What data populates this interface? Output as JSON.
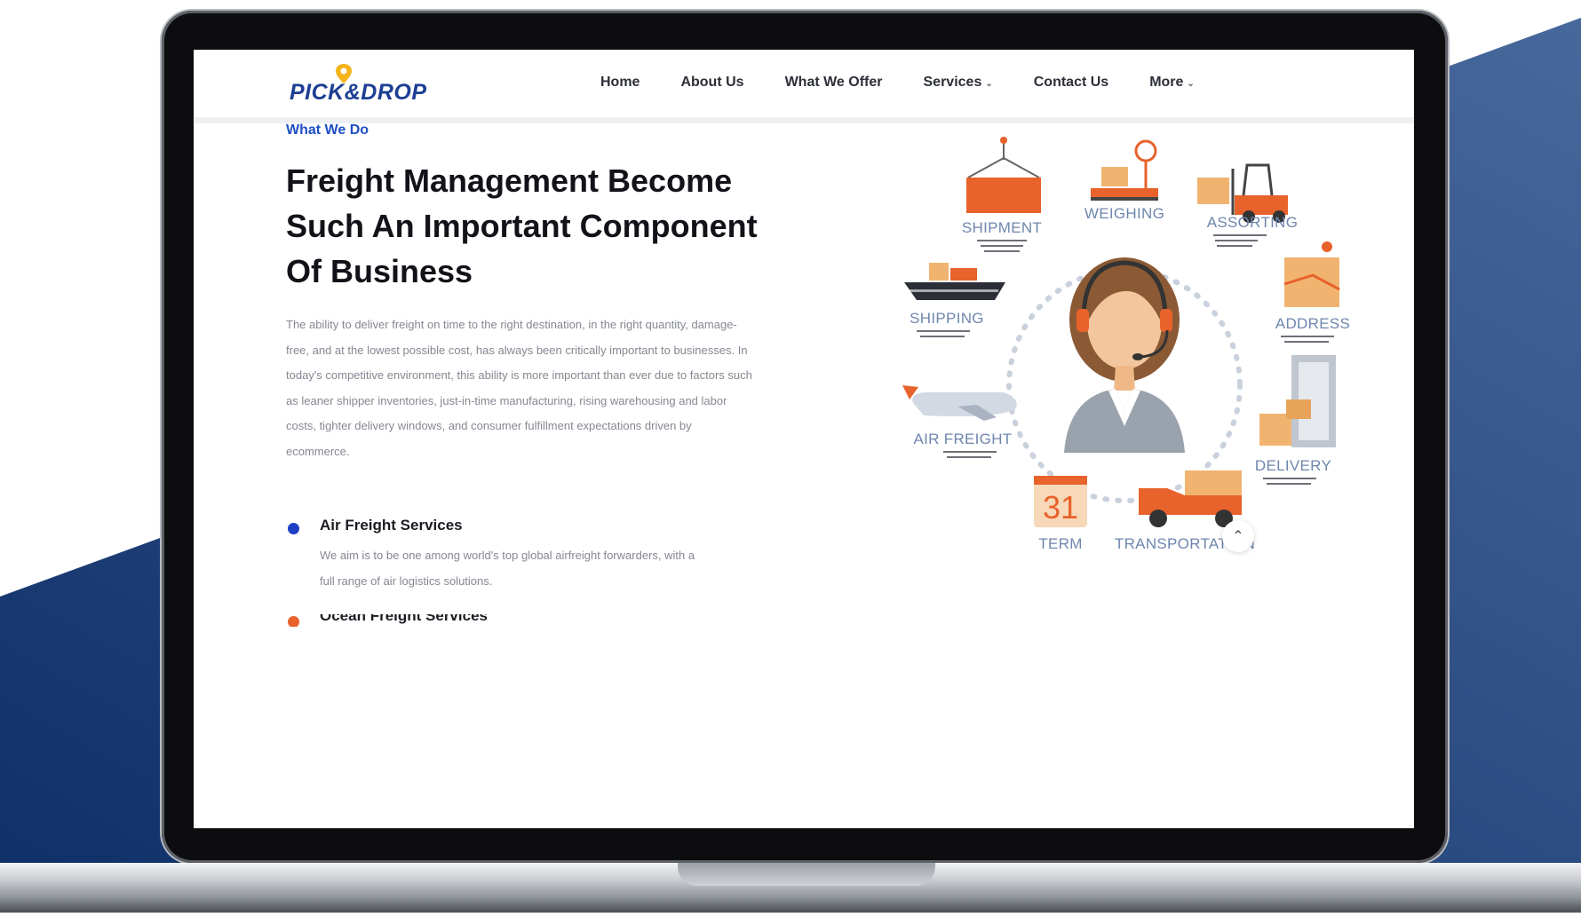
{
  "site": {
    "logo_text": "PICK&DROP",
    "accent_blue": "#1d4fc4",
    "accent_orange": "#e8622b"
  },
  "nav": {
    "items": [
      {
        "label": "Home",
        "has_caret": false
      },
      {
        "label": "About Us",
        "has_caret": false
      },
      {
        "label": "What We Offer",
        "has_caret": false
      },
      {
        "label": "Services",
        "has_caret": true
      },
      {
        "label": "Contact Us",
        "has_caret": false
      },
      {
        "label": "More",
        "has_caret": true
      }
    ]
  },
  "section": {
    "eyebrow": "What We Do",
    "heading": "Freight Management Become Such An Important Component Of Business",
    "description": "The ability to deliver freight on time to the right destination, in the right quantity, damage-free, and at the lowest possible cost, has always been critically important to businesses. In today's competitive environment, this ability is more important than ever due to factors such as leaner shipper inventories, just-in-time manufacturing, rising warehousing and labor costs, tighter delivery windows, and consumer fulfillment expectations driven by ecommerce."
  },
  "services": [
    {
      "title": "Air Freight Services",
      "text": "We aim is to be one among world's top global airfreight forwarders, with a full range of air logistics solutions.",
      "dot_color": "#1d3fc4"
    },
    {
      "title": "Ocean Freight Services",
      "text": "",
      "dot_color": "#e8622b"
    }
  ],
  "illustration": {
    "labels": {
      "shipment": "SHIPMENT",
      "weighing": "WEIGHING",
      "assorting": "ASSORTING",
      "shipping": "SHIPPING",
      "address": "ADDRESS",
      "air_freight": "AIR FREIGHT",
      "delivery": "DELIVERY",
      "term": "TERM",
      "transportation": "TRANSPORTATION",
      "calendar_day": "31"
    }
  },
  "icons": {
    "scroll_top": "chevron-up-icon",
    "caret": "chevron-down-icon"
  }
}
